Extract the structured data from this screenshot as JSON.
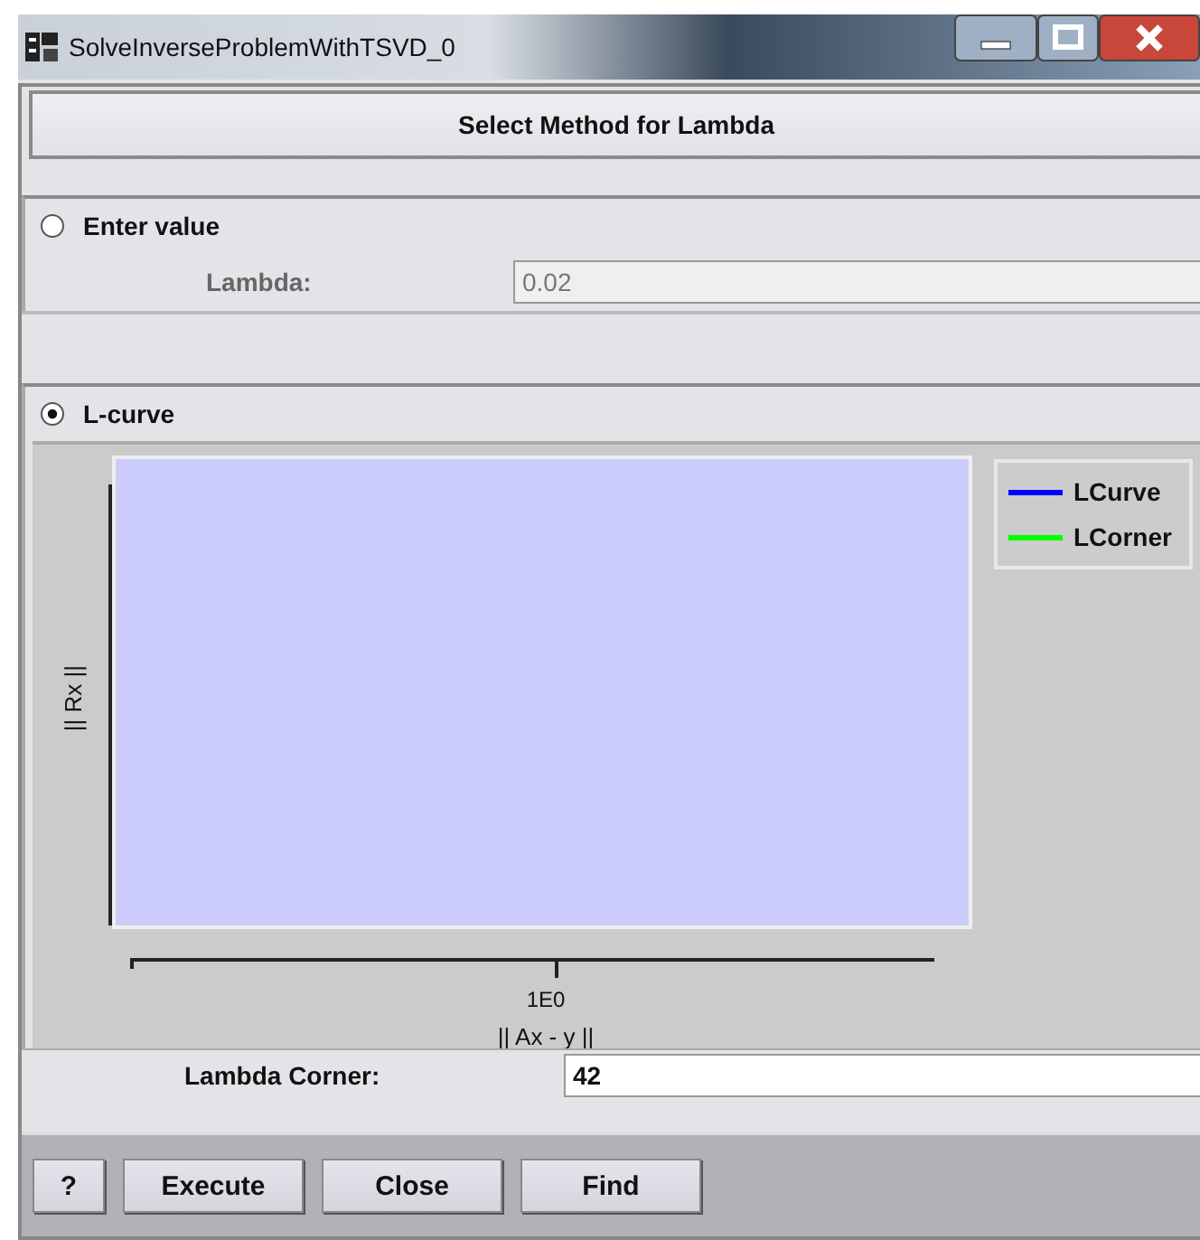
{
  "window": {
    "title": "SolveInverseProblemWithTSVD_0"
  },
  "header": "Select Method for Lambda",
  "methods": [
    {
      "label": "Enter value",
      "selected": false
    },
    {
      "label": "L-curve",
      "selected": true
    }
  ],
  "lambda": {
    "label": "Lambda:",
    "value": "0.02",
    "disabled": true
  },
  "plot": {
    "ylabel": "|| Rx ||",
    "xtick": "1E0",
    "xlabel": "|| Ax - y ||",
    "legend": [
      {
        "name": "LCurve",
        "color": "#0000ff"
      },
      {
        "name": "LCorner",
        "color": "#00ff00"
      }
    ]
  },
  "lambda_corner": {
    "label": "Lambda Corner:",
    "value": "42"
  },
  "buttons": [
    {
      "label": "?"
    },
    {
      "label": "Execute"
    },
    {
      "label": "Close"
    },
    {
      "label": "Find"
    }
  ]
}
